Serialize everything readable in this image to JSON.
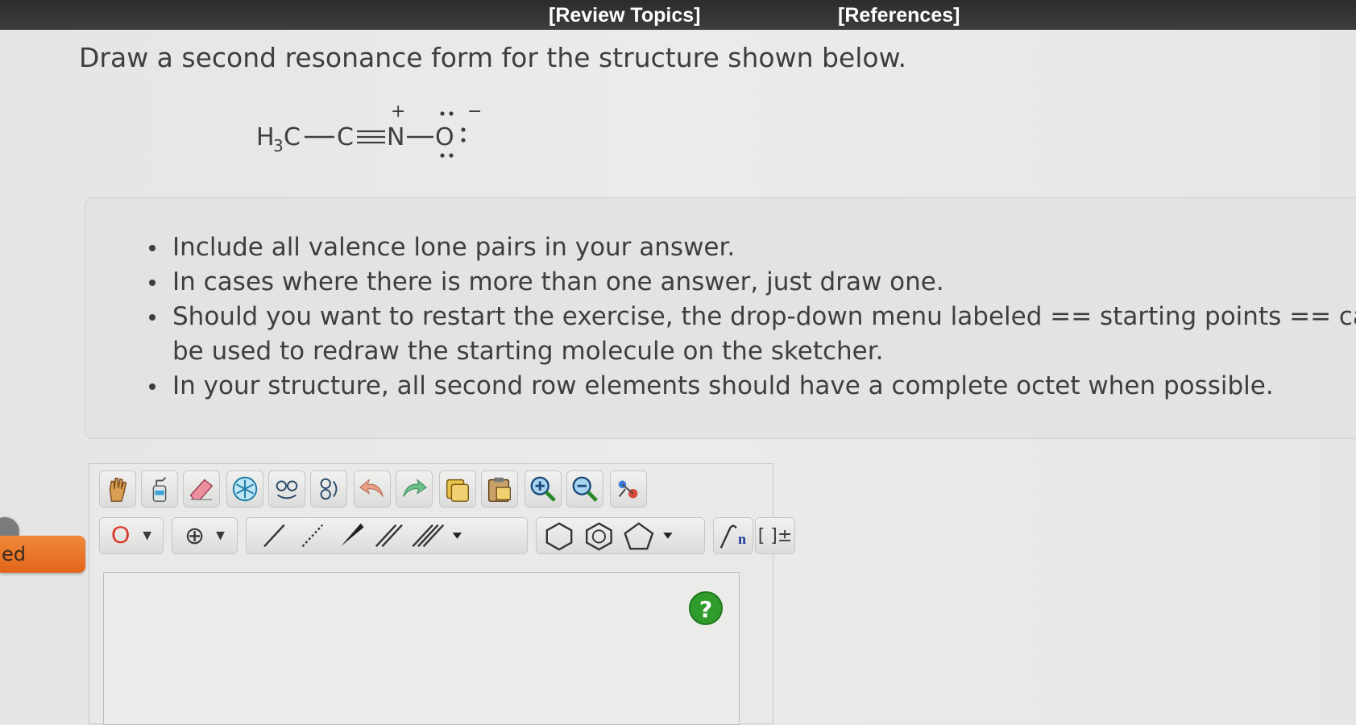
{
  "header": {
    "review_topics": "[Review Topics]",
    "references": "[References]"
  },
  "question": {
    "prompt": "Draw a second resonance form for the structure shown below."
  },
  "molecule": {
    "text": "H3C—C≡N—O:",
    "charges": {
      "N": "+",
      "O": "−"
    }
  },
  "instructions": [
    "Include all valence lone pairs in your answer.",
    "In cases where there is more than one answer, just draw one.",
    "Should you want to restart the exercise, the drop-down menu labeled == starting points == can",
    "be used to redraw the starting molecule on the sketcher.",
    "In your structure, all second row elements should have a complete octet when possible."
  ],
  "side_button": {
    "label": "ed"
  },
  "toolbar": {
    "row1": [
      "hand-icon",
      "spray-bottle-icon",
      "eraser-icon",
      "ring-template-icon",
      "clean-structure-icon",
      "rotate-structure-icon",
      "undo-icon",
      "redo-icon",
      "copy-icon",
      "paste-icon",
      "zoom-in-icon",
      "zoom-out-icon",
      "atom-properties-icon"
    ],
    "row2_atom": "O",
    "row2_charge": "⊕",
    "row2_bracket": "[ ]±",
    "row2_sgroup": "n"
  },
  "help": {
    "label": "?"
  },
  "colors": {
    "topbar": "#2b2c2d",
    "accent_orange": "#e2641a",
    "help_green": "#2f9c2c",
    "atom_red": "#d8392a"
  }
}
